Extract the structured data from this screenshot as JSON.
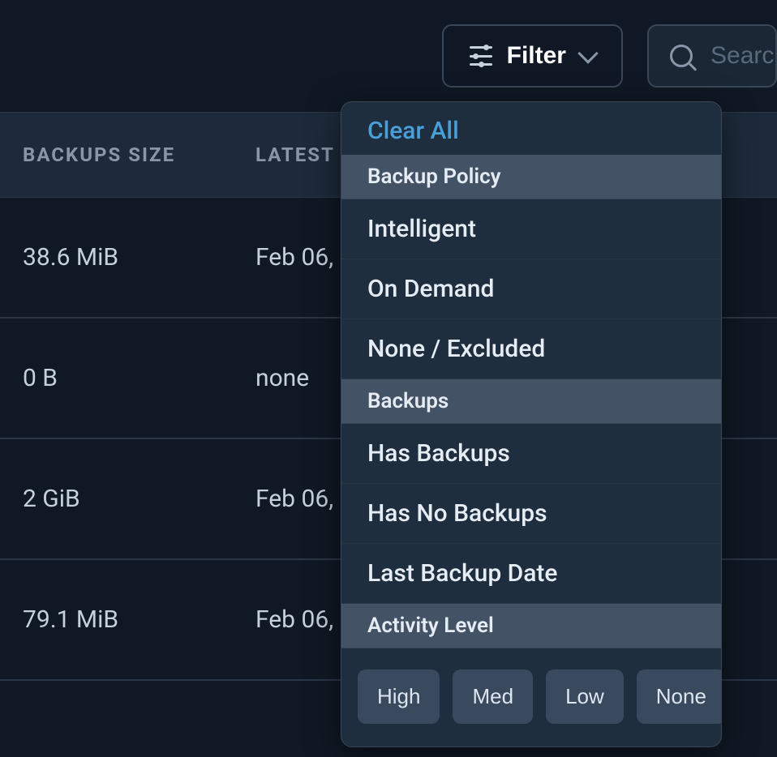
{
  "toolbar": {
    "filter_label": "Filter",
    "search_placeholder": "Search"
  },
  "table": {
    "headers": {
      "backups_size": "BACKUPS SIZE",
      "latest_backup": "LATEST B"
    },
    "rows": [
      {
        "size": "38.6 MiB",
        "latest": "Feb 06,"
      },
      {
        "size": "0 B",
        "latest": "none"
      },
      {
        "size": "2 GiB",
        "latest": "Feb 06,"
      },
      {
        "size": "79.1 MiB",
        "latest": "Feb 06,"
      }
    ]
  },
  "filter_menu": {
    "clear_all": "Clear All",
    "sections": {
      "backup_policy": {
        "header": "Backup Policy",
        "options": [
          "Intelligent",
          "On Demand",
          "None / Excluded"
        ]
      },
      "backups": {
        "header": "Backups",
        "options": [
          "Has Backups",
          "Has No Backups",
          "Last Backup Date"
        ]
      },
      "activity_level": {
        "header": "Activity Level",
        "buttons": [
          "High",
          "Med",
          "Low",
          "None"
        ]
      }
    }
  }
}
